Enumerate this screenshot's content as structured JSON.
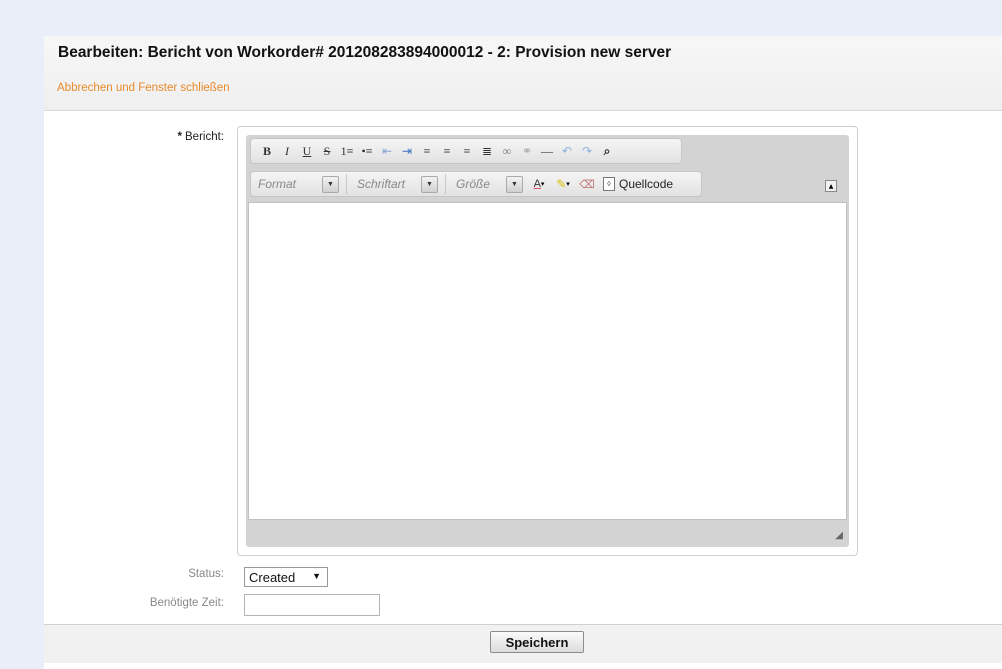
{
  "header": {
    "title": "Bearbeiten: Bericht von Workorder# 201208283894000012 - 2: Provision new server",
    "cancel_link": "Abbrechen und Fenster schließen"
  },
  "form": {
    "bericht_label": "Bericht:",
    "required_mark": "*",
    "status_label": "Status:",
    "status_value": "Created",
    "time_label": "Benötigte Zeit:",
    "time_value": ""
  },
  "editor": {
    "toolbar1": [
      {
        "name": "bold-button",
        "glyph": "B"
      },
      {
        "name": "italic-button",
        "glyph": "I"
      },
      {
        "name": "underline-button",
        "glyph": "U"
      },
      {
        "name": "strikethrough-button",
        "glyph": "S"
      },
      {
        "name": "numbered-list-icon",
        "glyph": "1≡"
      },
      {
        "name": "bulleted-list-icon",
        "glyph": "•≡"
      },
      {
        "name": "outdent-icon",
        "glyph": "⇤"
      },
      {
        "name": "indent-icon",
        "glyph": "⇥"
      },
      {
        "name": "align-left-icon",
        "glyph": "≡"
      },
      {
        "name": "align-center-icon",
        "glyph": "≡"
      },
      {
        "name": "align-right-icon",
        "glyph": "≡"
      },
      {
        "name": "align-justify-icon",
        "glyph": "≣"
      },
      {
        "name": "link-icon",
        "glyph": "∞"
      },
      {
        "name": "unlink-icon",
        "glyph": "⚭"
      },
      {
        "name": "horizontal-rule-icon",
        "glyph": "—"
      },
      {
        "name": "undo-icon",
        "glyph": "↶"
      },
      {
        "name": "redo-icon",
        "glyph": "↷"
      },
      {
        "name": "find-icon",
        "glyph": "⌕"
      }
    ],
    "format_placeholder": "Format",
    "font_placeholder": "Schriftart",
    "size_placeholder": "Größe",
    "text_color_glyph": "A",
    "source_label": "Quellcode",
    "content": ""
  },
  "footer": {
    "save_label": "Speichern"
  },
  "colors": {
    "link": "#e88a2a",
    "page_bg": "#e9eef8",
    "editor_frame": "#d3d3d3"
  }
}
